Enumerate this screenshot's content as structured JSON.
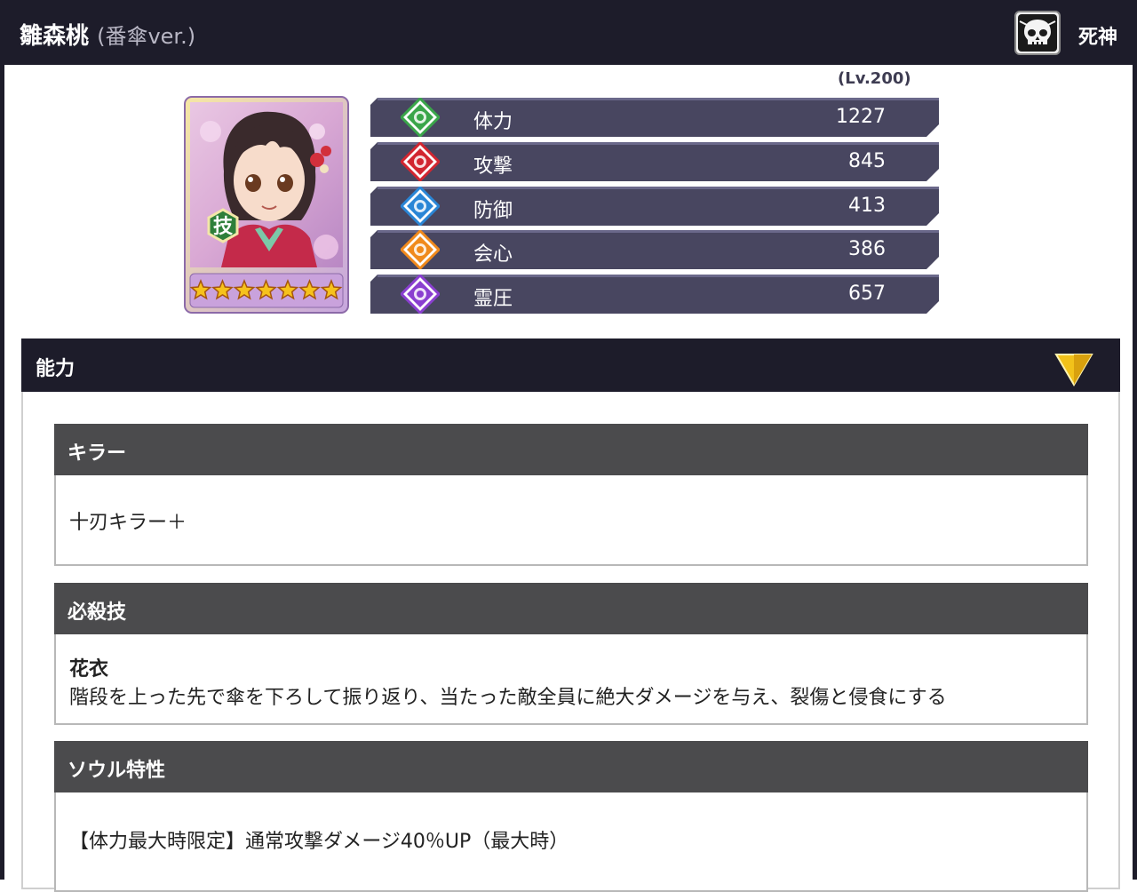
{
  "header": {
    "name": "雛森桃",
    "variant": "(番傘ver.)",
    "type_label": "死神",
    "type_icon": "skull-icon"
  },
  "level": "(Lv.200)",
  "card": {
    "badge": "技",
    "star_count": 7
  },
  "stats": [
    {
      "name": "体力",
      "value": "1227",
      "icon": "hp-icon",
      "color": "#3aa64a"
    },
    {
      "name": "攻撃",
      "value": "845",
      "icon": "attack-icon",
      "color": "#d22630"
    },
    {
      "name": "防御",
      "value": "413",
      "icon": "defense-icon",
      "color": "#2a86d6"
    },
    {
      "name": "会心",
      "value": "386",
      "icon": "critical-icon",
      "color": "#f08a1c"
    },
    {
      "name": "霊圧",
      "value": "657",
      "icon": "spirit-pressure-icon",
      "color": "#8a3fd0"
    }
  ],
  "ability": {
    "title": "能力",
    "killer": {
      "heading": "キラー",
      "text": "十刃キラー＋"
    },
    "special": {
      "heading": "必殺技",
      "name": "花衣",
      "description": "階段を上った先で傘を下ろして振り返り、当たった敵全員に絶大ダメージを与え、裂傷と侵食にする"
    },
    "soul": {
      "heading": "ソウル特性",
      "text": "【体力最大時限定】通常攻撃ダメージ40％UP（最大時）"
    }
  },
  "colors": {
    "header_bg": "#1d1c2a",
    "stat_bar": "#484660",
    "subheader_bg": "#4b4b4d",
    "toggle": "#f2c21a"
  }
}
